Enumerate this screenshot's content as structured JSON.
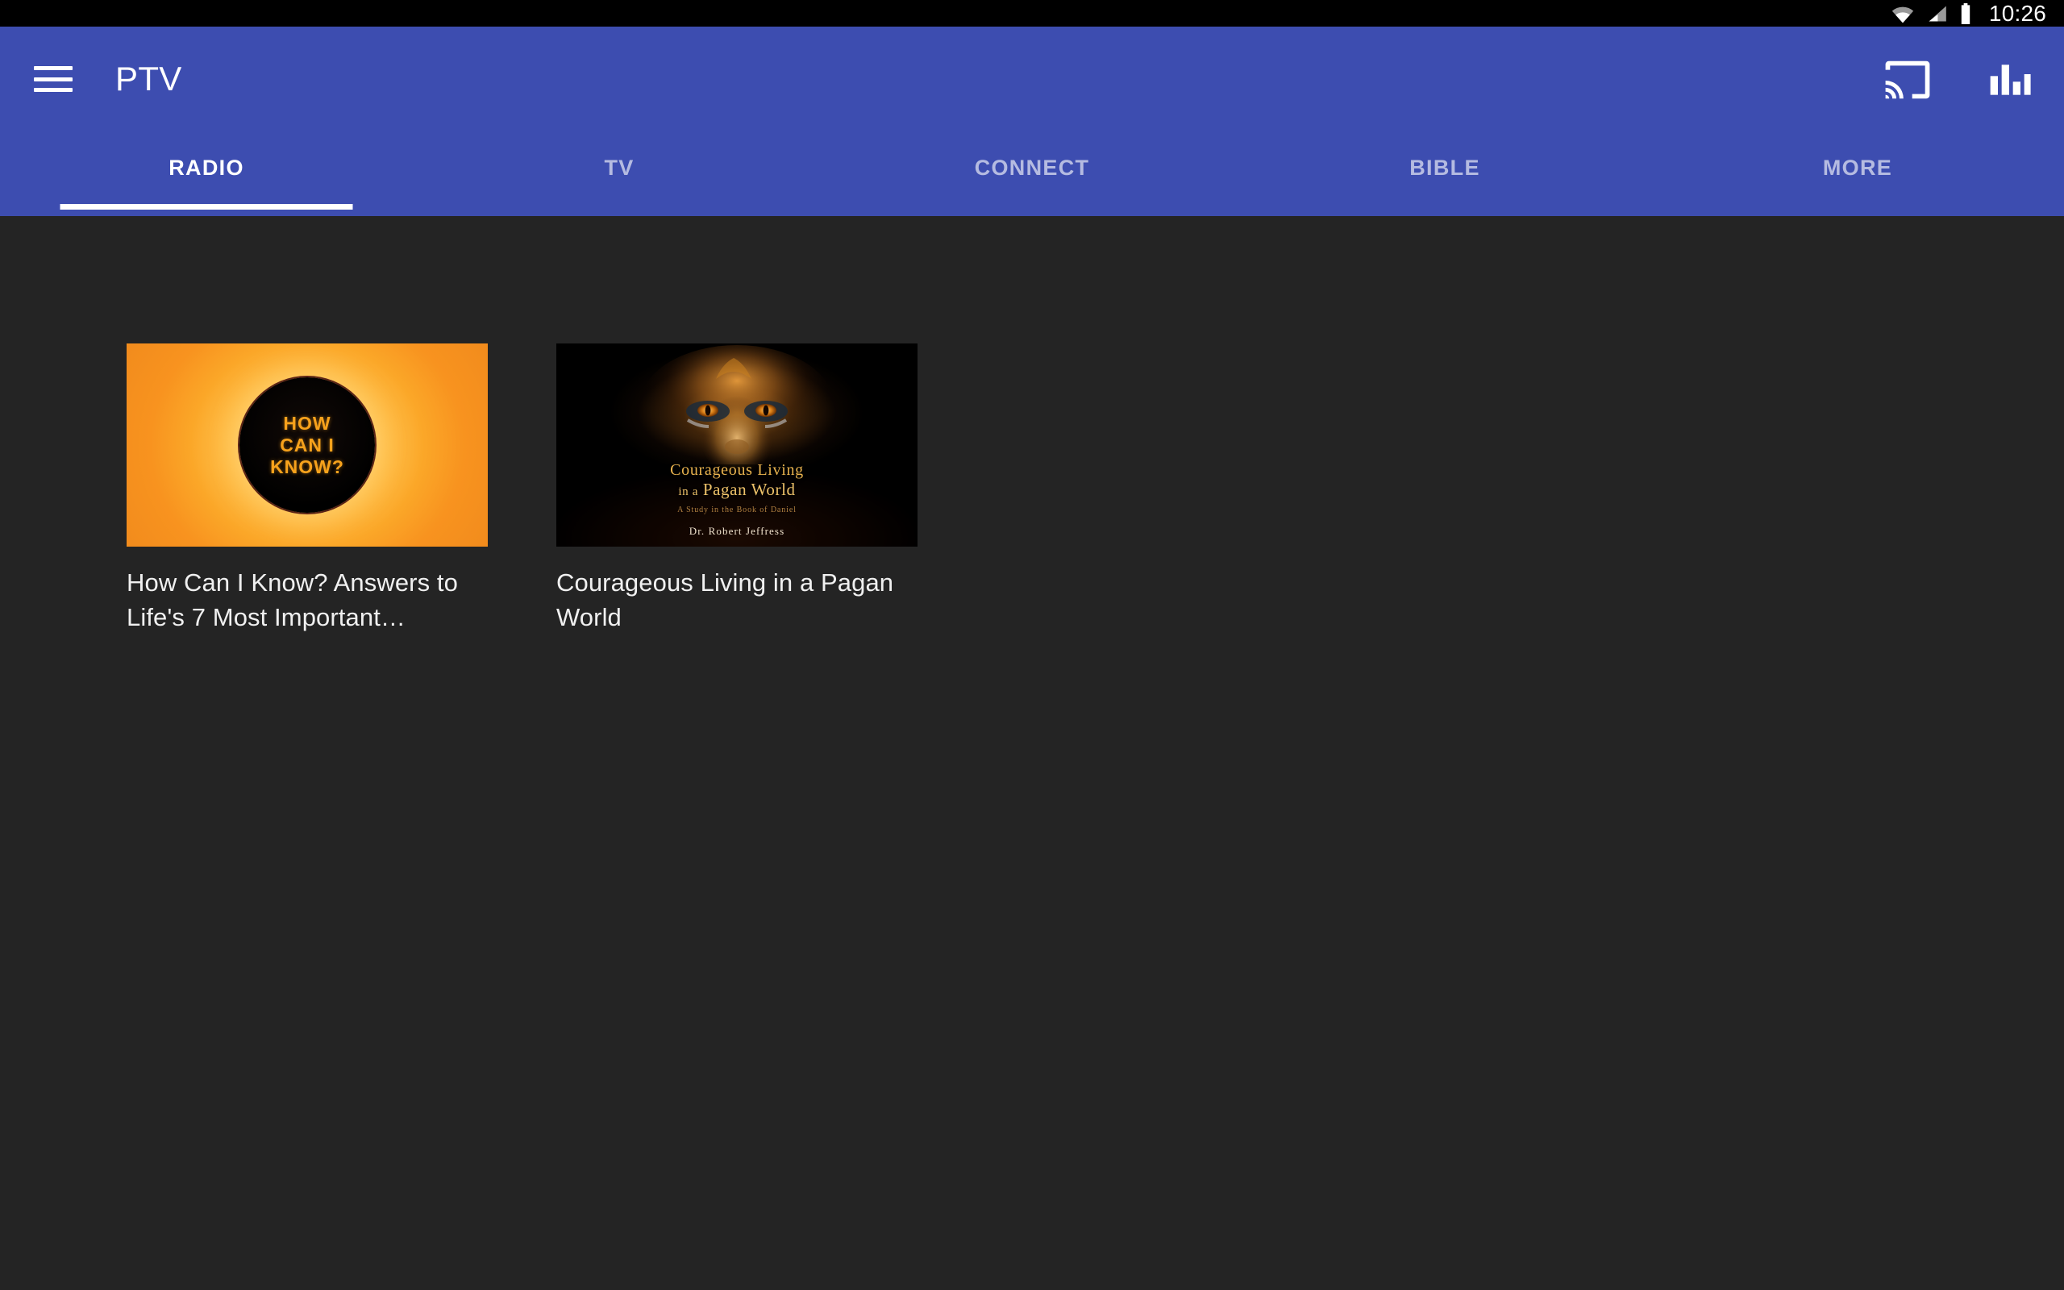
{
  "status_bar": {
    "icons": [
      "wifi-icon",
      "cellular-signal-icon",
      "battery-icon"
    ],
    "time": "10:26",
    "background_color": "#000000"
  },
  "app_bar": {
    "background_color": "#3d4db0",
    "menu_icon": "hamburger-menu-icon",
    "title": "PTV",
    "actions": [
      {
        "icon": "cast-icon",
        "label": "Cast"
      },
      {
        "icon": "equalizer-icon",
        "label": "Equalizer"
      }
    ]
  },
  "tabs": {
    "active_index": 0,
    "indicator_color": "#ffffff",
    "items": [
      {
        "label": "RADIO"
      },
      {
        "label": "TV"
      },
      {
        "label": "CONNECT"
      },
      {
        "label": "BIBLE"
      },
      {
        "label": "MORE"
      }
    ]
  },
  "content": {
    "background_color": "#242424",
    "cards": [
      {
        "caption": "How Can I Know? Answers to Life's 7 Most Important…",
        "thumbnail": {
          "art_name": "how-can-i-know-artwork",
          "accent_color": "#f7a21c",
          "background_color": "#f8931f",
          "lines": [
            "HOW",
            "CAN I",
            "KNOW?"
          ]
        }
      },
      {
        "caption": "Courageous Living in a Pagan World",
        "thumbnail": {
          "art_name": "courageous-living-lion-artwork",
          "accent_color": "#e8b24e",
          "background_color": "#000000",
          "title_line1": "Courageous Living",
          "title_line2_small": "in a",
          "title_line2": "Pagan World",
          "subtitle": "A Study in the Book of Daniel",
          "author": "Dr. Robert Jeffress"
        }
      }
    ]
  }
}
